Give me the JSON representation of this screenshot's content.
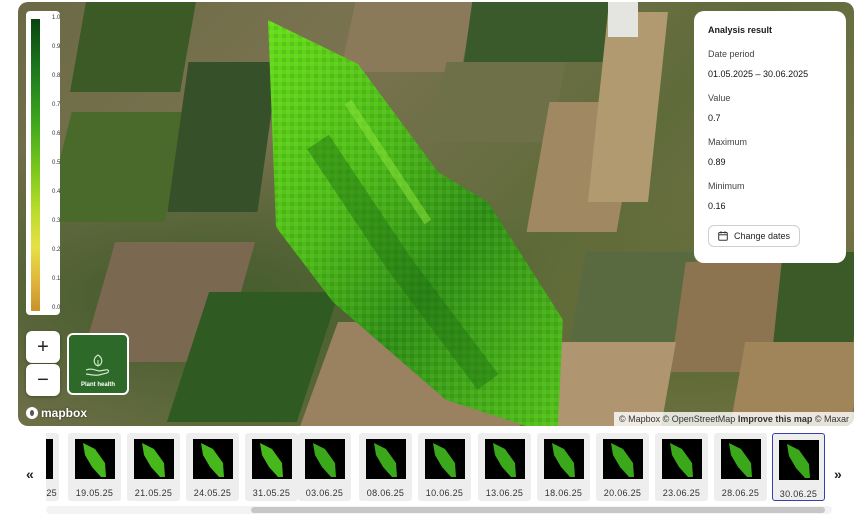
{
  "legend": {
    "ticks": [
      "1.0",
      "0.9",
      "0.8",
      "0.7",
      "0.6",
      "0.5",
      "0.4",
      "0.3",
      "0.2",
      "0.1",
      "0.0"
    ]
  },
  "map_controls": {
    "zoom_in": "+",
    "zoom_out": "−",
    "layer_label": "Plant health"
  },
  "analysis": {
    "title": "Analysis result",
    "date_period_label": "Date period",
    "date_period_value": "01.05.2025 – 30.06.2025",
    "value_label": "Value",
    "value": "0.7",
    "maximum_label": "Maximum",
    "maximum": "0.89",
    "minimum_label": "Minimum",
    "minimum": "0.16",
    "change_button": "Change dates"
  },
  "map_footer": {
    "logo": "mapbox",
    "attr_mapbox": "© Mapbox",
    "attr_osm": "© OpenStreetMap",
    "attr_improve": "Improve this map",
    "attr_maxar": "© Maxar"
  },
  "timeline": {
    "prev_arrow": "«",
    "next_arrow": "»",
    "dates": [
      "25",
      "19.05.25",
      "21.05.25",
      "24.05.25",
      "31.05.25",
      "03.06.25",
      "08.06.25",
      "10.06.25",
      "13.06.25",
      "18.06.25",
      "20.06.25",
      "23.06.25",
      "28.06.25",
      "30.06.25"
    ],
    "selected": "30.06.25"
  },
  "colors": {
    "accent": "#3a3ea8",
    "field_bright": "#5fd81a",
    "field_dark": "#2a8c1a"
  }
}
